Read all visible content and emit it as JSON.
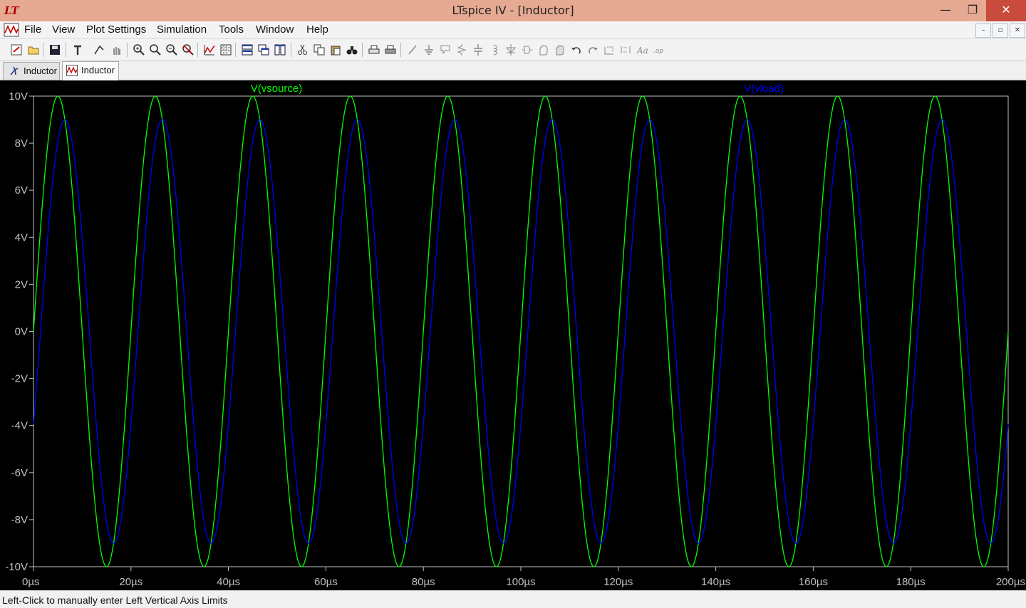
{
  "window": {
    "title": "LTspice IV - [Inductor]",
    "controls": {
      "minimize": "—",
      "maximize": "❐",
      "close": "✕"
    }
  },
  "menu": {
    "items": [
      "File",
      "View",
      "Plot Settings",
      "Simulation",
      "Tools",
      "Window",
      "Help"
    ]
  },
  "mdi_controls": [
    "–",
    "▫",
    "✕"
  ],
  "tabs": [
    {
      "label": "Inductor",
      "icon": "schematic-icon",
      "active": false
    },
    {
      "label": "Inductor",
      "icon": "waveform-icon",
      "active": true
    }
  ],
  "toolbar": {
    "icons": [
      "run-icon",
      "open-icon",
      "save-icon",
      "control-panel-icon",
      "halt-icon",
      "pan-icon",
      "zoom-in-icon",
      "zoom-area-icon",
      "zoom-out-icon",
      "zoom-cancel-icon",
      "autorange-icon",
      "grid-icon",
      "tile-horizontal-icon",
      "cascade-icon",
      "tile-vertical-icon",
      "cut-icon",
      "copy-icon",
      "paste-icon",
      "find-icon",
      "print-preview-icon",
      "print-icon",
      "wire-icon",
      "ground-icon",
      "label-icon",
      "resistor-icon",
      "capacitor-icon",
      "inductor-icon",
      "diode-icon",
      "component-icon",
      "move-icon",
      "drag-icon",
      "undo-icon",
      "redo-icon",
      "rotate-icon",
      "mirror-icon",
      "text-icon",
      "spice-directive-icon"
    ]
  },
  "colors": {
    "plot_background": "#000000",
    "axis": "#c0c0c0",
    "vsource": "#00ff00",
    "vload": "#0000ff"
  },
  "status": "Left-Click to manually enter Left Vertical Axis Limits",
  "chart_data": {
    "type": "line",
    "title": "",
    "xlabel": "",
    "ylabel": "",
    "xlim": [
      0,
      200
    ],
    "x_unit": "µs",
    "ylim": [
      -10,
      10
    ],
    "y_unit": "V",
    "x_ticks": [
      "0µs",
      "20µs",
      "40µs",
      "60µs",
      "80µs",
      "100µs",
      "120µs",
      "140µs",
      "160µs",
      "180µs",
      "200µs"
    ],
    "y_ticks": [
      "10V",
      "8V",
      "6V",
      "4V",
      "2V",
      "0V",
      "-2V",
      "-4V",
      "-6V",
      "-8V",
      "-10V"
    ],
    "grid": false,
    "legend": "top",
    "series": [
      {
        "name": "V(vsource)",
        "color": "#00ff00",
        "waveform": "sine",
        "amplitude": 10,
        "frequency_khz": 50,
        "phase_deg": 0
      },
      {
        "name": "V(vload)",
        "color": "#0000ff",
        "waveform": "sine",
        "amplitude": 9,
        "frequency_khz": 50,
        "phase_deg": -26
      }
    ]
  }
}
